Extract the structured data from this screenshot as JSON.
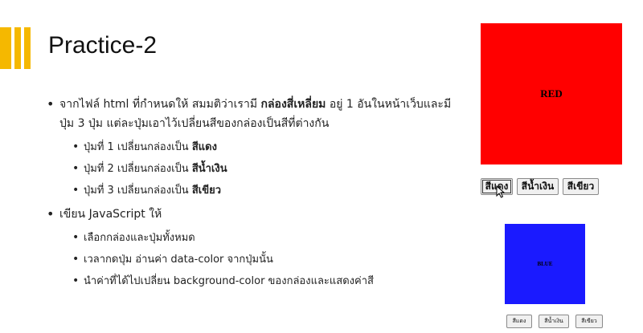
{
  "slide": {
    "title": "Practice-2",
    "bullets": [
      {
        "pre": "จากไฟล์ html ที่กำหนดให้ สมมติว่าเรามี ",
        "bold": "กล่องสี่เหลี่ยม",
        "post": " อยู่ 1 อันในหน้าเว็บและมีปุ่ม 3 ปุ่ม แต่ละปุ่มเอาไว้เปลี่ยนสีของกล่องเป็นสีที่ต่างกัน",
        "subs": [
          {
            "pre": "ปุ่มที่ 1  เปลี่ยนกล่องเป็น ",
            "bold": "สีแดง"
          },
          {
            "pre": "ปุ่มที่ 2  เปลี่ยนกล่องเป็น ",
            "bold": "สีน้ำเงิน"
          },
          {
            "pre": "ปุ่มที่ 3  เปลี่ยนกล่องเป็น ",
            "bold": "สีเขียว"
          }
        ]
      },
      {
        "pre": "เขียน JavaScript ให้",
        "subs": [
          {
            "pre": "เลือกกล่องและปุ่มทั้งหมด"
          },
          {
            "pre": "เวลากดปุ่ม อ่านค่า data-color จากปุ่มนั้น"
          },
          {
            "pre": "นำค่าที่ได้ไปเปลี่ยน background-color ของกล่องและแสดงค่าสี"
          }
        ]
      }
    ]
  },
  "demo_large": {
    "box_label": "RED",
    "box_color": "#ff0000",
    "buttons": [
      "สีแดง",
      "สีน้ำเงิน",
      "สีเขียว"
    ]
  },
  "demo_small": {
    "box_label": "BLUE",
    "box_color": "#1a1aff",
    "buttons": [
      "สีแดง",
      "สีน้ำเงิน",
      "สีเขียว"
    ]
  },
  "colors": {
    "accent": "#f5b800"
  },
  "cursor_icon": "mouse-pointer-icon"
}
